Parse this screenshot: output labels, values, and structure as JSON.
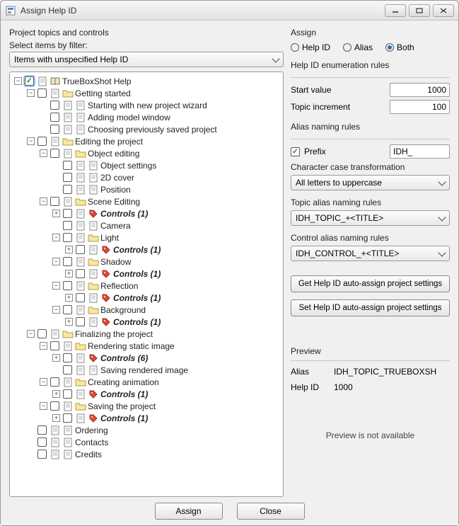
{
  "window": {
    "title": "Assign Help ID"
  },
  "left": {
    "heading": "Project topics and controls",
    "filter_label": "Select items by filter:",
    "filter_value": "Items with unspecified Help ID"
  },
  "tree": {
    "root": {
      "label": "TrueBoxShot Help",
      "checked": true,
      "children": [
        {
          "label": "Getting started",
          "children": [
            {
              "label": "Starting with new project wizard"
            },
            {
              "label": "Adding model window"
            },
            {
              "label": "Choosing previously saved project"
            }
          ]
        },
        {
          "label": "Editing the project",
          "children": [
            {
              "label": "Object editing",
              "children": [
                {
                  "label": "Object settings"
                },
                {
                  "label": "2D cover"
                },
                {
                  "label": "Position"
                }
              ]
            },
            {
              "label": "Scene Editing",
              "children": [
                {
                  "label": "Controls (1)",
                  "ctrl": true,
                  "closed": true
                },
                {
                  "label": "Camera"
                },
                {
                  "label": "Light",
                  "children": [
                    {
                      "label": "Controls (1)",
                      "ctrl": true,
                      "closed": true
                    }
                  ]
                },
                {
                  "label": "Shadow",
                  "children": [
                    {
                      "label": "Controls (1)",
                      "ctrl": true,
                      "closed": true
                    }
                  ]
                },
                {
                  "label": "Reflection",
                  "children": [
                    {
                      "label": "Controls (1)",
                      "ctrl": true,
                      "closed": true
                    }
                  ]
                },
                {
                  "label": "Background",
                  "children": [
                    {
                      "label": "Controls (1)",
                      "ctrl": true,
                      "closed": true
                    }
                  ]
                }
              ]
            }
          ]
        },
        {
          "label": "Finalizing the project",
          "children": [
            {
              "label": "Rendering static image",
              "children": [
                {
                  "label": "Controls (6)",
                  "ctrl": true,
                  "closed": true
                },
                {
                  "label": "Saving rendered image"
                }
              ]
            },
            {
              "label": "Creating animation",
              "children": [
                {
                  "label": "Controls (1)",
                  "ctrl": true,
                  "closed": true
                }
              ]
            },
            {
              "label": "Saving the project",
              "children": [
                {
                  "label": "Controls (1)",
                  "ctrl": true,
                  "closed": true
                }
              ]
            }
          ]
        },
        {
          "label": "Ordering"
        },
        {
          "label": "Contacts"
        },
        {
          "label": "Credits"
        }
      ]
    }
  },
  "right": {
    "assign_label": "Assign",
    "radio_helpid": "Help ID",
    "radio_alias": "Alias",
    "radio_both": "Both",
    "radio_selected": "both",
    "enum_heading": "Help ID enumeration rules",
    "start_label": "Start value",
    "start_value": "1000",
    "inc_label": "Topic increment",
    "inc_value": "100",
    "alias_heading": "Alias naming rules",
    "prefix_checked": true,
    "prefix_label": "Prefix",
    "prefix_value": "IDH_",
    "case_label": "Character case transformation",
    "case_value": "All letters to uppercase",
    "topic_rules_label": "Topic alias naming rules",
    "topic_rules_value": "IDH_TOPIC_+<TITLE>",
    "control_rules_label": "Control alias naming rules",
    "control_rules_value": "IDH_CONTROL_+<TITLE>",
    "btn_get": "Get Help ID auto-assign project settings",
    "btn_set": "Set Help ID auto-assign project settings",
    "preview_label": "Preview",
    "preview_alias_label": "Alias",
    "preview_alias_value": "IDH_TOPIC_TRUEBOXSH",
    "preview_helpid_label": "Help ID",
    "preview_helpid_value": "1000",
    "preview_unavailable": "Preview is not available"
  },
  "buttons": {
    "assign": "Assign",
    "close": "Close"
  }
}
